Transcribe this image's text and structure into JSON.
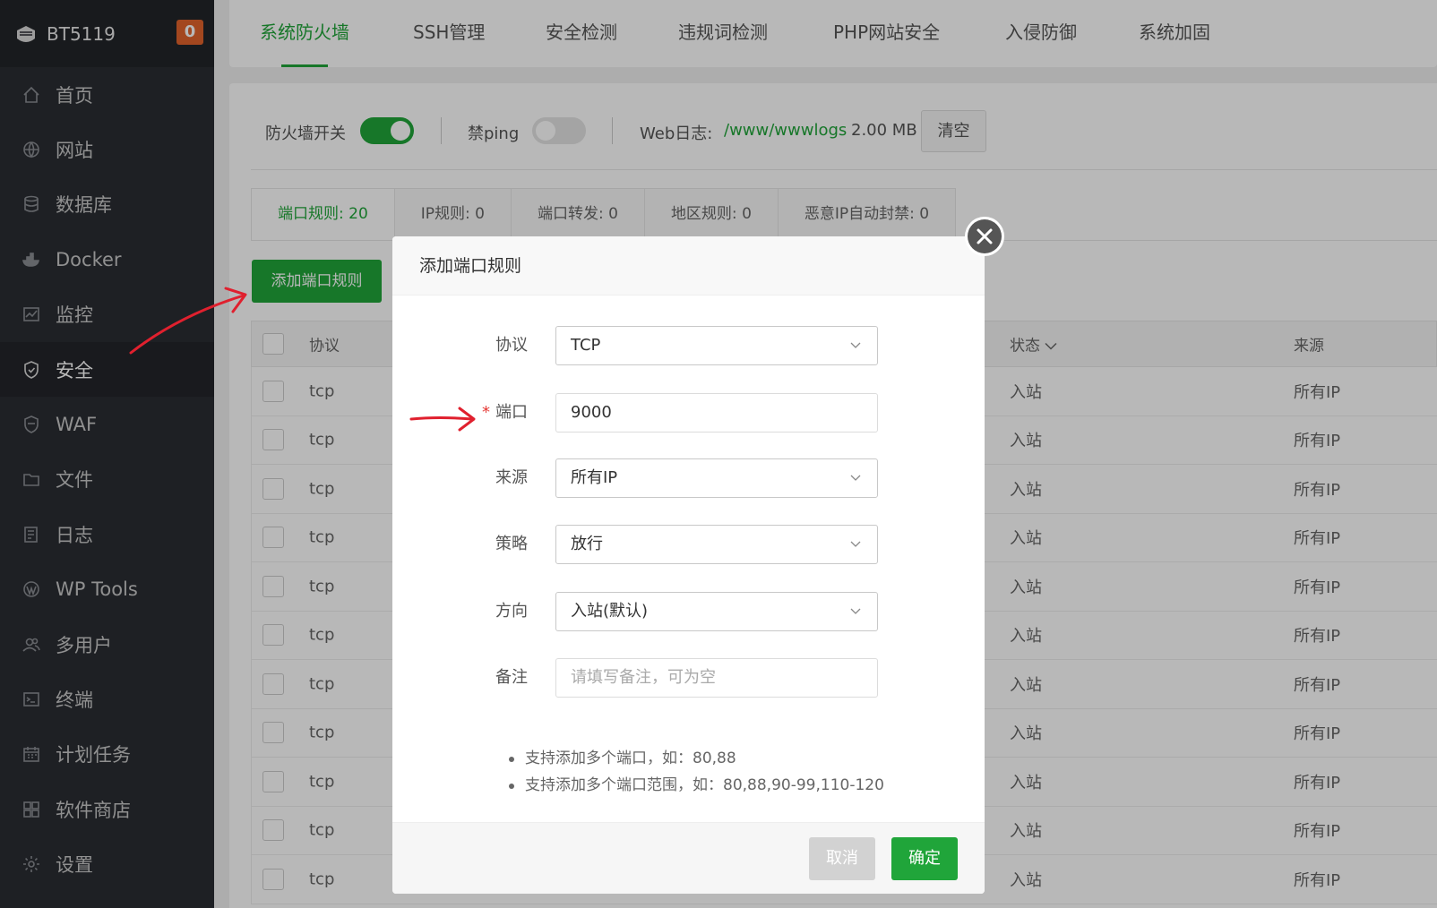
{
  "brand": {
    "name": "BT5119",
    "badge": "0"
  },
  "sidebar": {
    "items": [
      {
        "label": "首页",
        "icon": "home-icon"
      },
      {
        "label": "网站",
        "icon": "globe-icon"
      },
      {
        "label": "数据库",
        "icon": "database-icon"
      },
      {
        "label": "Docker",
        "icon": "docker-icon"
      },
      {
        "label": "监控",
        "icon": "monitor-icon"
      },
      {
        "label": "安全",
        "icon": "shield-icon",
        "active": true
      },
      {
        "label": "WAF",
        "icon": "waf-shield-icon"
      },
      {
        "label": "文件",
        "icon": "folder-icon"
      },
      {
        "label": "日志",
        "icon": "log-icon"
      },
      {
        "label": "WP Tools",
        "icon": "wordpress-icon"
      },
      {
        "label": "多用户",
        "icon": "users-icon"
      },
      {
        "label": "终端",
        "icon": "terminal-icon"
      },
      {
        "label": "计划任务",
        "icon": "calendar-icon"
      },
      {
        "label": "软件商店",
        "icon": "apps-icon"
      },
      {
        "label": "设置",
        "icon": "gear-icon"
      }
    ]
  },
  "tabs": [
    "系统防火墙",
    "SSH管理",
    "安全检测",
    "违规词检测",
    "PHP网站安全",
    "入侵防御",
    "系统加固"
  ],
  "controls": {
    "firewall_label": "防火墙开关",
    "ping_label": "禁ping",
    "weblog_label": "Web日志:",
    "weblog_path": "/www/wwwlogs",
    "weblog_size": "2.00 MB",
    "clear_label": "清空"
  },
  "subtabs": [
    "端口规则: 20",
    "IP规则: 0",
    "端口转发: 0",
    "地区规则: 0",
    "恶意IP自动封禁: 0"
  ],
  "add_rule_label": "添加端口规则",
  "table": {
    "headers": {
      "protocol": "协议",
      "status": "状态",
      "source": "来源"
    },
    "rows": [
      {
        "protocol": "tcp",
        "status": "入站",
        "source": "所有IP"
      },
      {
        "protocol": "tcp",
        "status": "入站",
        "source": "所有IP"
      },
      {
        "protocol": "tcp",
        "status": "入站",
        "source": "所有IP"
      },
      {
        "protocol": "tcp",
        "status": "入站",
        "source": "所有IP"
      },
      {
        "protocol": "tcp",
        "status": "入站",
        "source": "所有IP"
      },
      {
        "protocol": "tcp",
        "status": "入站",
        "source": "所有IP"
      },
      {
        "protocol": "tcp",
        "status": "入站",
        "source": "所有IP"
      },
      {
        "protocol": "tcp",
        "status": "入站",
        "source": "所有IP"
      },
      {
        "protocol": "tcp",
        "status": "入站",
        "source": "所有IP"
      },
      {
        "protocol": "tcp",
        "status": "入站",
        "source": "所有IP"
      },
      {
        "protocol": "tcp",
        "status": "入站",
        "source": "所有IP"
      }
    ]
  },
  "modal": {
    "title": "添加端口规则",
    "fields": {
      "protocol": {
        "label": "协议",
        "value": "TCP"
      },
      "port": {
        "label": "端口",
        "value": "9000",
        "required": "*"
      },
      "source": {
        "label": "来源",
        "value": "所有IP"
      },
      "policy": {
        "label": "策略",
        "value": "放行"
      },
      "direction": {
        "label": "方向",
        "value": "入站(默认)"
      },
      "note": {
        "label": "备注",
        "placeholder": "请填写备注，可为空"
      }
    },
    "hints": [
      "支持添加多个端口，如：80,88",
      "支持添加多个端口范围，如：80,88,90-99,110-120"
    ],
    "cancel_label": "取消",
    "confirm_label": "确定"
  },
  "colors": {
    "accent": "#20a53a",
    "sidebar_bg": "#2a2d33",
    "badge": "#e2632b",
    "annotation": "#e0202e"
  }
}
